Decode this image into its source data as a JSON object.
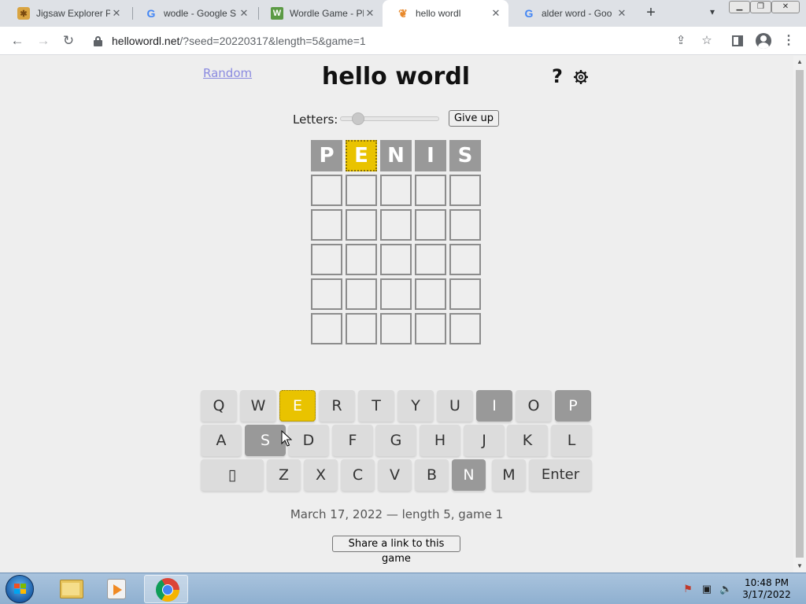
{
  "browser": {
    "tabs": [
      {
        "title": "Jigsaw Explorer Pu",
        "icon": "jigsaw-icon",
        "active": false
      },
      {
        "title": "wodle - Google S",
        "icon": "google-icon",
        "active": false
      },
      {
        "title": "Wordle Game - Pl",
        "icon": "wordle-icon",
        "active": false
      },
      {
        "title": "hello wordl",
        "icon": "hello-wordl-icon",
        "active": true
      },
      {
        "title": "alder word - Goo",
        "icon": "google-icon",
        "active": false
      }
    ],
    "url_host": "hellowordl.net",
    "url_rest": "/?seed=20220317&length=5&game=1"
  },
  "page": {
    "random_link": "Random",
    "title": "hello wordl",
    "help_label": "?",
    "letters_label": "Letters:",
    "letters_value": 5,
    "giveup_label": "Give up",
    "board": [
      [
        {
          "letter": "P",
          "state": "absent"
        },
        {
          "letter": "E",
          "state": "present"
        },
        {
          "letter": "N",
          "state": "absent"
        },
        {
          "letter": "I",
          "state": "absent"
        },
        {
          "letter": "S",
          "state": "absent"
        }
      ],
      [
        {
          "letter": "",
          "state": "empty"
        },
        {
          "letter": "",
          "state": "empty"
        },
        {
          "letter": "",
          "state": "empty"
        },
        {
          "letter": "",
          "state": "empty"
        },
        {
          "letter": "",
          "state": "empty"
        }
      ],
      [
        {
          "letter": "",
          "state": "empty"
        },
        {
          "letter": "",
          "state": "empty"
        },
        {
          "letter": "",
          "state": "empty"
        },
        {
          "letter": "",
          "state": "empty"
        },
        {
          "letter": "",
          "state": "empty"
        }
      ],
      [
        {
          "letter": "",
          "state": "empty"
        },
        {
          "letter": "",
          "state": "empty"
        },
        {
          "letter": "",
          "state": "empty"
        },
        {
          "letter": "",
          "state": "empty"
        },
        {
          "letter": "",
          "state": "empty"
        }
      ],
      [
        {
          "letter": "",
          "state": "empty"
        },
        {
          "letter": "",
          "state": "empty"
        },
        {
          "letter": "",
          "state": "empty"
        },
        {
          "letter": "",
          "state": "empty"
        },
        {
          "letter": "",
          "state": "empty"
        }
      ],
      [
        {
          "letter": "",
          "state": "empty"
        },
        {
          "letter": "",
          "state": "empty"
        },
        {
          "letter": "",
          "state": "empty"
        },
        {
          "letter": "",
          "state": "empty"
        },
        {
          "letter": "",
          "state": "empty"
        }
      ]
    ],
    "keyboard": [
      [
        {
          "label": "Q",
          "state": ""
        },
        {
          "label": "W",
          "state": ""
        },
        {
          "label": "E",
          "state": "present"
        },
        {
          "label": "R",
          "state": ""
        },
        {
          "label": "T",
          "state": ""
        },
        {
          "label": "Y",
          "state": ""
        },
        {
          "label": "U",
          "state": ""
        },
        {
          "label": "I",
          "state": "absent"
        },
        {
          "label": "O",
          "state": ""
        },
        {
          "label": "P",
          "state": "absent"
        }
      ],
      [
        {
          "label": "A",
          "state": ""
        },
        {
          "label": "S",
          "state": "absent"
        },
        {
          "label": "D",
          "state": ""
        },
        {
          "label": "F",
          "state": ""
        },
        {
          "label": "G",
          "state": ""
        },
        {
          "label": "H",
          "state": ""
        },
        {
          "label": "J",
          "state": ""
        },
        {
          "label": "K",
          "state": ""
        },
        {
          "label": "L",
          "state": ""
        }
      ],
      [
        {
          "label": "▯",
          "state": ""
        },
        {
          "label": "Z",
          "state": ""
        },
        {
          "label": "X",
          "state": ""
        },
        {
          "label": "C",
          "state": ""
        },
        {
          "label": "V",
          "state": ""
        },
        {
          "label": "B",
          "state": ""
        },
        {
          "label": "N",
          "state": "absent"
        },
        {
          "label": "M",
          "state": ""
        },
        {
          "label": "Enter",
          "state": ""
        }
      ]
    ],
    "game_info": "March 17, 2022 — length 5, game 1",
    "share_label": "Share a link to this game"
  },
  "taskbar": {
    "time": "10:48 PM",
    "date": "3/17/2022"
  },
  "colors": {
    "absent": "#999999",
    "present": "#e9c300",
    "background": "#eeeeee"
  }
}
